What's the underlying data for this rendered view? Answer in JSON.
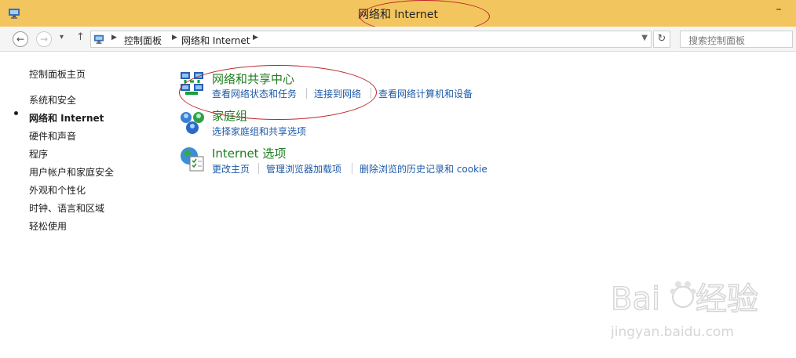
{
  "window": {
    "title": "网络和 Internet",
    "minimize_glyph": "–"
  },
  "address_bar": {
    "crumbs": [
      "控制面板",
      "网络和 Internet"
    ],
    "search_placeholder": "搜索控制面板"
  },
  "left_nav": {
    "items": [
      {
        "label": "控制面板主页",
        "active": false
      },
      {
        "label": "系统和安全",
        "active": false
      },
      {
        "label": "网络和 Internet",
        "active": true
      },
      {
        "label": "硬件和声音",
        "active": false
      },
      {
        "label": "程序",
        "active": false
      },
      {
        "label": "用户帐户和家庭安全",
        "active": false
      },
      {
        "label": "外观和个性化",
        "active": false
      },
      {
        "label": "时钟、语言和区域",
        "active": false
      },
      {
        "label": "轻松使用",
        "active": false
      }
    ]
  },
  "categories": [
    {
      "title": "网络和共享中心",
      "icon": "network-sharing-icon",
      "links": [
        "查看网络状态和任务",
        "连接到网络",
        "查看网络计算机和设备"
      ]
    },
    {
      "title": "家庭组",
      "icon": "homegroup-icon",
      "links": [
        "选择家庭组和共享选项"
      ]
    },
    {
      "title": "Internet 选项",
      "icon": "internet-options-icon",
      "links": [
        "更改主页",
        "管理浏览器加载项",
        "删除浏览的历史记录和 cookie"
      ]
    }
  ],
  "watermark": {
    "brand": "Baidu经验",
    "url": "jingyan.baidu.com"
  },
  "colors": {
    "titlebar": "#f3c55f",
    "category_title": "#1f7d1f",
    "link": "#1e5aa8",
    "annotation": "#c0262b"
  }
}
